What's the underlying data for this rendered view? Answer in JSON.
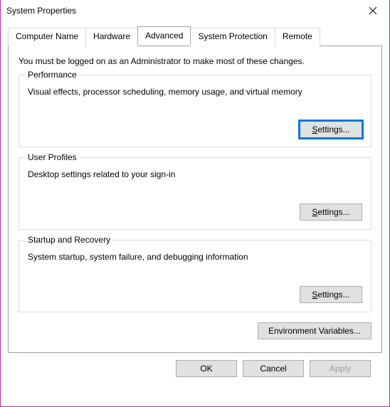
{
  "window": {
    "title": "System Properties"
  },
  "tabs": {
    "computer_name": "Computer Name",
    "hardware": "Hardware",
    "advanced": "Advanced",
    "system_protection": "System Protection",
    "remote": "Remote"
  },
  "instruction": "You must be logged on as an Administrator to make most of these changes.",
  "groups": {
    "performance": {
      "title": "Performance",
      "desc": "Visual effects, processor scheduling, memory usage, and virtual memory",
      "button_prefix": "S",
      "button_rest": "ettings..."
    },
    "user_profiles": {
      "title": "User Profiles",
      "desc": "Desktop settings related to your sign-in",
      "button_prefix": "S",
      "button_rest": "ettings..."
    },
    "startup": {
      "title": "Startup and Recovery",
      "desc": "System startup, system failure, and debugging information",
      "button_prefix": "S",
      "button_rest": "ettings..."
    }
  },
  "env_button": "Environment Variables...",
  "footer": {
    "ok": "OK",
    "cancel": "Cancel",
    "apply": "Apply"
  }
}
